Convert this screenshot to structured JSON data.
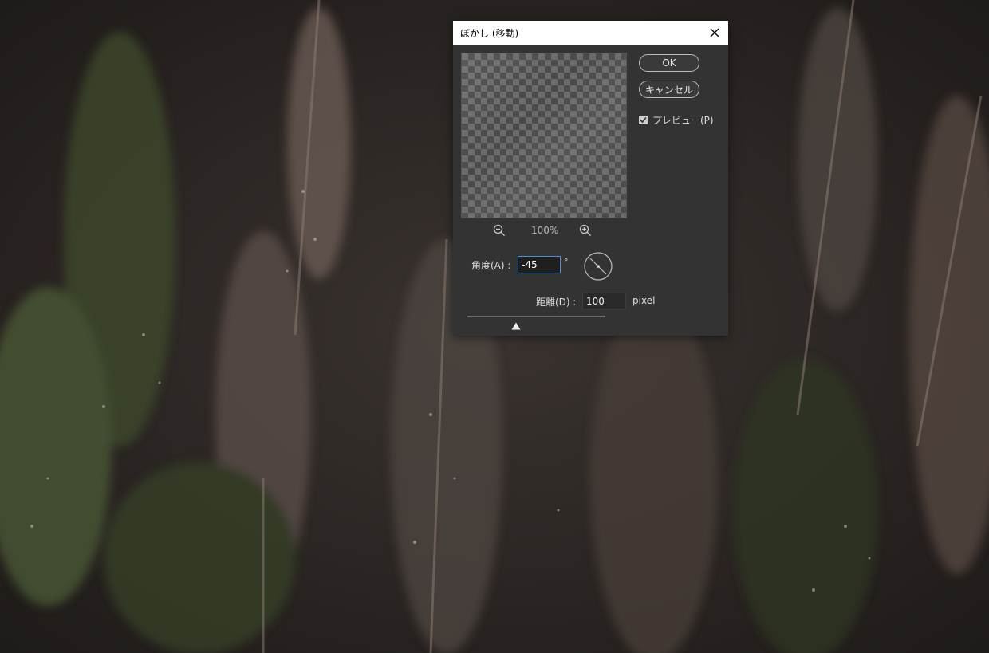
{
  "dialog": {
    "title": "ぼかし (移動)",
    "ok_label": "OK",
    "cancel_label": "キャンセル",
    "preview_label": "プレビュー(P)",
    "preview_checked": true,
    "zoom_level": "100%",
    "angle_label": "角度(A) :",
    "angle_value": "-45",
    "angle_unit": "°",
    "distance_label": "距離(D) :",
    "distance_value": "100",
    "distance_unit": "pixel",
    "distance_slider_fraction": 0.35
  },
  "icons": {
    "close": "close-icon",
    "zoom_out": "zoom-out-icon",
    "zoom_in": "zoom-in-icon",
    "check": "check-icon",
    "angle_dial": "angle-dial-icon",
    "slider_thumb": "slider-thumb-icon"
  },
  "colors": {
    "dialog_bg": "#333333",
    "accent_focus": "#4a90e2"
  }
}
